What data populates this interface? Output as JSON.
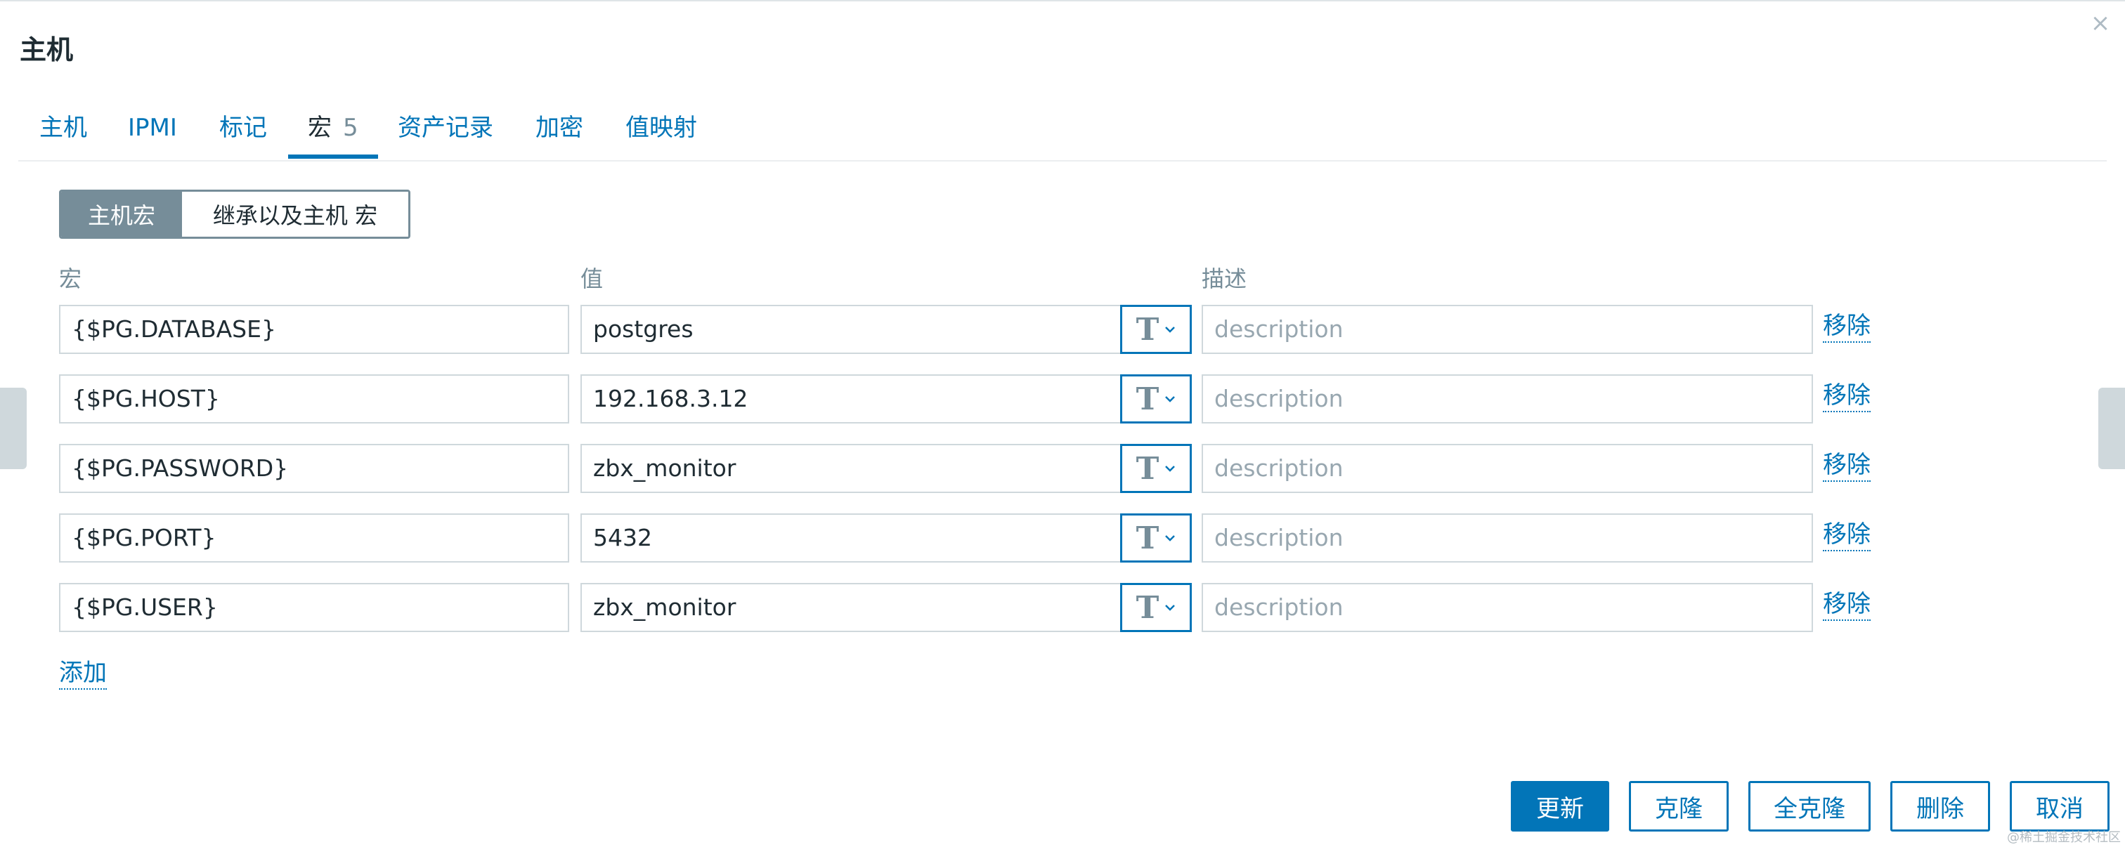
{
  "dialog": {
    "title": "主机",
    "close_glyph": "×"
  },
  "tabs": [
    {
      "label": "主机"
    },
    {
      "label": "IPMI"
    },
    {
      "label": "标记"
    },
    {
      "label": "宏",
      "count": "5",
      "active": true
    },
    {
      "label": "资产记录"
    },
    {
      "label": "加密"
    },
    {
      "label": "值映射"
    }
  ],
  "macro_mode": {
    "host_macros": "主机宏",
    "inherited_macros": "继承以及主机 宏"
  },
  "columns": {
    "macro": "宏",
    "value": "值",
    "description": "描述"
  },
  "macros": [
    {
      "macro": "{$PG.DATABASE}",
      "value": "postgres",
      "type_glyph": "T",
      "description_placeholder": "description",
      "remove_label": "移除"
    },
    {
      "macro": "{$PG.HOST}",
      "value": "192.168.3.12",
      "type_glyph": "T",
      "description_placeholder": "description",
      "remove_label": "移除"
    },
    {
      "macro": "{$PG.PASSWORD}",
      "value": "zbx_monitor",
      "type_glyph": "T",
      "description_placeholder": "description",
      "remove_label": "移除"
    },
    {
      "macro": "{$PG.PORT}",
      "value": "5432",
      "type_glyph": "T",
      "description_placeholder": "description",
      "remove_label": "移除"
    },
    {
      "macro": "{$PG.USER}",
      "value": "zbx_monitor",
      "type_glyph": "T",
      "description_placeholder": "description",
      "remove_label": "移除"
    }
  ],
  "add_label": "添加",
  "footer": {
    "update": "更新",
    "clone": "克隆",
    "full_clone": "全克隆",
    "delete": "删除",
    "cancel": "取消"
  },
  "watermark": "@稀土掘金技术社区",
  "colors": {
    "accent": "#0275b8",
    "segment_active": "#768d99",
    "input_border": "#cfd8dc",
    "muted_text": "#768d99"
  }
}
